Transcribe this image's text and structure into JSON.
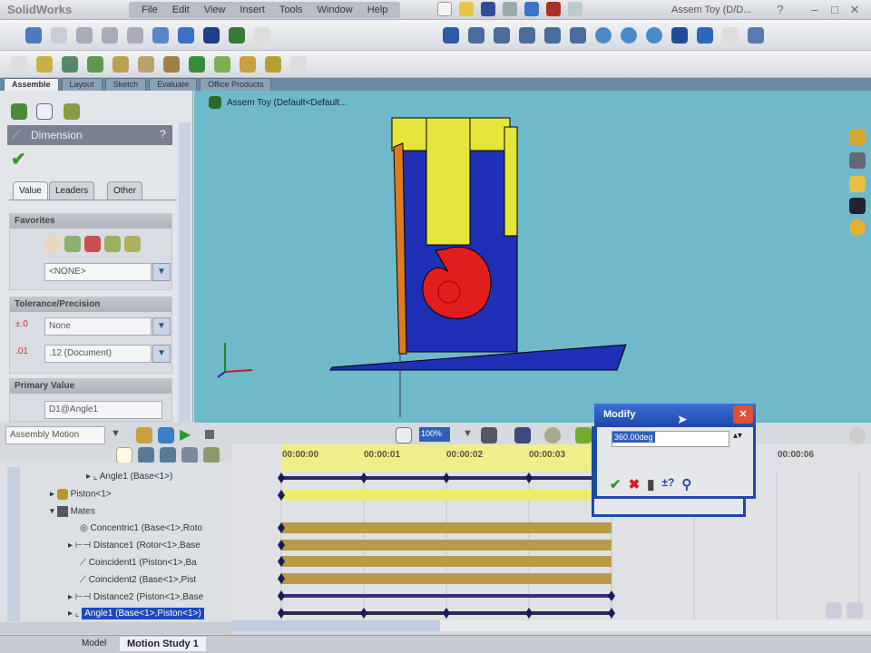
{
  "app": {
    "logo": "SolidWorks",
    "title": "Assem Toy (D/D...",
    "help": "?"
  },
  "menu": [
    "File",
    "Edit",
    "View",
    "Insert",
    "Tools",
    "Window",
    "Help"
  ],
  "command_tabs": [
    "Assemble",
    "Layout",
    "Sketch",
    "Evaluate",
    "Office Products"
  ],
  "property_manager": {
    "title": "Dimension",
    "help": "?",
    "tabs": [
      "Value",
      "Leaders",
      "Other"
    ],
    "favorites": {
      "header": "Favorites",
      "select": "<NONE>"
    },
    "tolerance": {
      "header": "Tolerance/Precision",
      "tolerance_type": "None",
      "precision": ".12 (Document)"
    },
    "primary_value": {
      "header": "Primary Value",
      "value": "D1@Angle1"
    }
  },
  "viewport": {
    "tree_label": "Assem Toy (Default<Default..."
  },
  "motion": {
    "study_type": "Assembly Motion",
    "zoom_value": "100%",
    "tree": [
      {
        "label": "Angle1 (Base<1>)",
        "icon": "angle-mate-icon"
      },
      {
        "label": "Piston<1>",
        "icon": "part-icon"
      },
      {
        "label": "Mates",
        "icon": "mates-folder-icon"
      },
      {
        "label": "Concentric1 (Base<1>,Roto",
        "icon": "concentric-icon"
      },
      {
        "label": "Distance1 (Rotor<1>,Base",
        "icon": "distance-icon"
      },
      {
        "label": "Coincident1 (Piston<1>,Ba",
        "icon": "coincident-icon"
      },
      {
        "label": "Coincident2 (Base<1>,Pist",
        "icon": "coincident-icon"
      },
      {
        "label": "Distance2 (Piston<1>,Base",
        "icon": "distance-icon"
      },
      {
        "label": "Angle1 (Base<1>,Piston<1>)",
        "icon": "angle-mate-icon",
        "selected": true
      }
    ],
    "timestamps": [
      "00:00:00",
      "00:00:01",
      "00:00:02",
      "00:00:03",
      "00:00:06"
    ],
    "tabs": [
      "Model",
      "Motion Study 1"
    ]
  },
  "modify_dialog": {
    "title": "Modify",
    "value": "360.00deg"
  },
  "colors": {
    "viewport": "#6fb9cb",
    "accent": "#1d49a8"
  }
}
